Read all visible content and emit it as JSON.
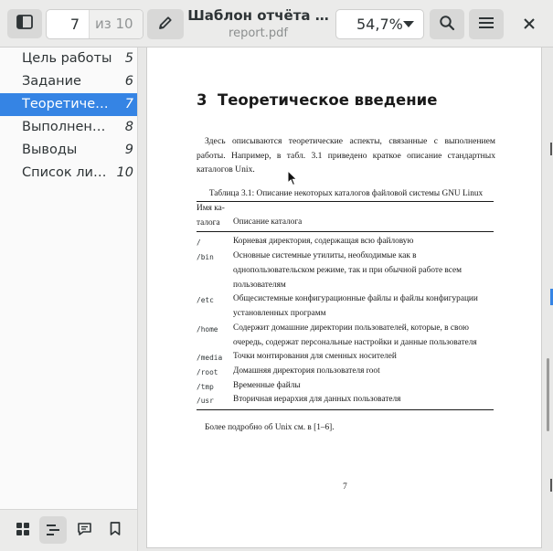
{
  "header": {
    "title": "Шаблон отчёта …",
    "subtitle": "report.pdf",
    "page_current": "7",
    "page_total": "из 10",
    "zoom": "54,7%"
  },
  "icons": {
    "sidebar_toggle": "sidebar-icon",
    "annotate": "pencil-icon",
    "search": "search-icon",
    "menu": "hamburger-menu-icon",
    "close": "close-icon"
  },
  "outline": [
    {
      "label": "Цель работы",
      "page": "5",
      "active": false
    },
    {
      "label": "Задание",
      "page": "6",
      "active": false
    },
    {
      "label": "Теоретическое введение",
      "page": "7",
      "active": true
    },
    {
      "label": "Выполнение лабораторной работы",
      "page": "8",
      "active": false
    },
    {
      "label": "Выводы",
      "page": "9",
      "active": false
    },
    {
      "label": "Список литературы",
      "page": "10",
      "active": false
    }
  ],
  "colors": {
    "accent": "#3584e4"
  },
  "document": {
    "section_number": "3",
    "section_title": "Теоретическое введение",
    "paragraph": "Здесь описываются теоретические аспекты, связанные с выполнением работы. Например, в табл. 3.1 приведено краткое описание стандартных каталогов Unix.",
    "table_caption": "Таблица 3.1: Описание некоторых каталогов файловой системы GNU Linux",
    "col1_header_line1": "Имя ка-",
    "col1_header_line2": "талога",
    "col2_header": "Описание каталога",
    "rows": [
      {
        "dir": "/",
        "desc": "Корневая директория, содержащая всю файловую"
      },
      {
        "dir": "/bin",
        "desc": "Основные системные утилиты, необходимые как в однопользовательском режиме, так и при обычной работе всем пользователям"
      },
      {
        "dir": "/etc",
        "desc": "Общесистемные конфигурационные файлы и файлы конфигурации установленных программ"
      },
      {
        "dir": "/home",
        "desc": "Содержит домашние директории пользователей, которые, в свою очередь, содержат персональные настройки и данные пользователя"
      },
      {
        "dir": "/media",
        "desc": "Точки монтирования для сменных носителей"
      },
      {
        "dir": "/root",
        "desc": "Домашняя директория пользователя root"
      },
      {
        "dir": "/tmp",
        "desc": "Временные файлы"
      },
      {
        "dir": "/usr",
        "desc": "Вторичная иерархия для данных пользователя"
      }
    ],
    "after_table": "Более подробно об Unix см. в [1–6].",
    "page_number": "7"
  }
}
